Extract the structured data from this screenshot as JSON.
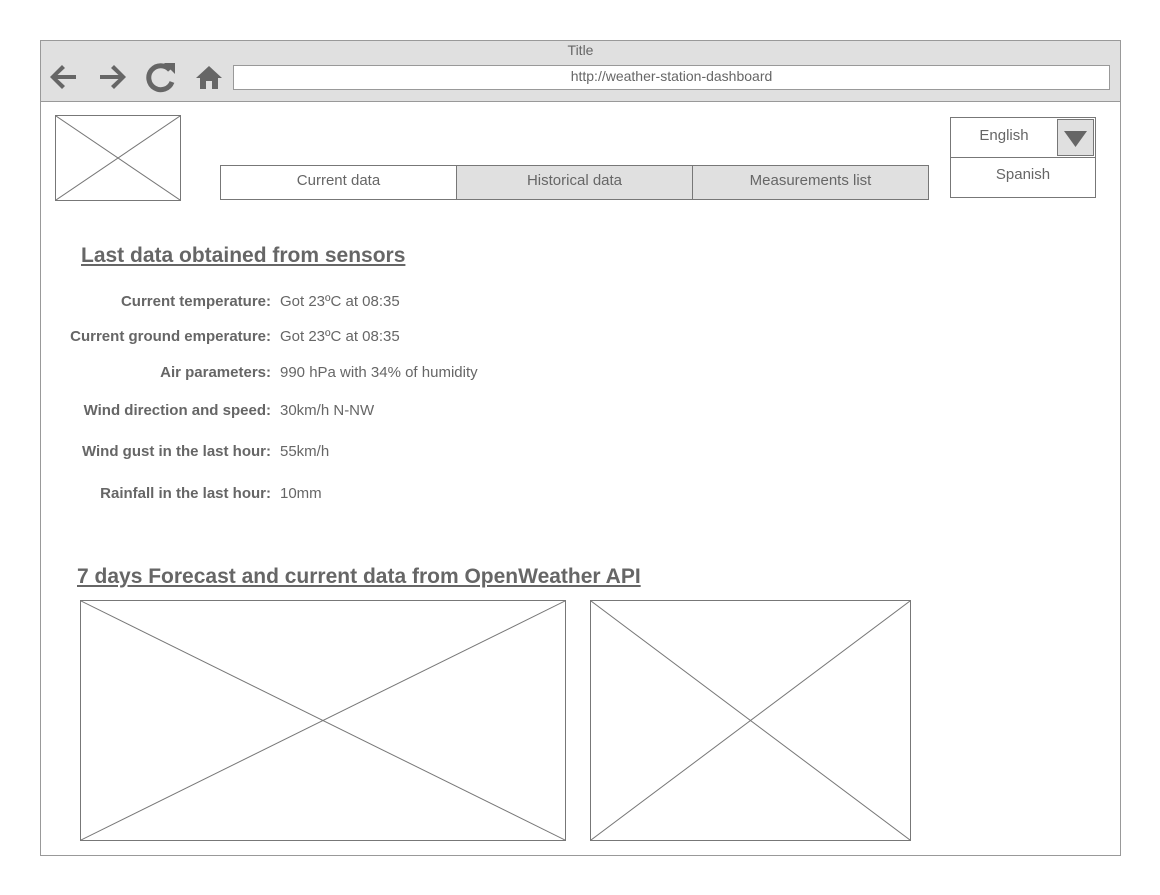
{
  "window": {
    "title": "Title",
    "url": "http://weather-station-dashboard"
  },
  "nav_icons": [
    "back-arrow-icon",
    "forward-arrow-icon",
    "reload-icon",
    "home-icon"
  ],
  "tabs": [
    {
      "label": "Current data",
      "active": true
    },
    {
      "label": "Historical data",
      "active": false
    },
    {
      "label": "Measurements list",
      "active": false
    }
  ],
  "language": {
    "selected": "English",
    "options": [
      "Spanish"
    ]
  },
  "sensors": {
    "heading": "Last data obtained from sensors",
    "rows": [
      {
        "label": "Current temperature:",
        "value": "Got 23ºC at 08:35"
      },
      {
        "label": "Current ground emperature:",
        "value": "Got 23ºC at 08:35"
      },
      {
        "label": "Air parameters:",
        "value": "990 hPa with 34% of humidity"
      },
      {
        "label": "Wind direction and speed:",
        "value": "30km/h N-NW"
      },
      {
        "label": "Wind gust in the last hour:",
        "value": "55km/h"
      },
      {
        "label": "Rainfall in the last hour:",
        "value": "10mm"
      }
    ]
  },
  "forecast": {
    "heading": "7 days Forecast and current data from OpenWeather API"
  },
  "colors": {
    "chrome": "#e0e0e0",
    "border": "#999999",
    "text": "#666666"
  }
}
